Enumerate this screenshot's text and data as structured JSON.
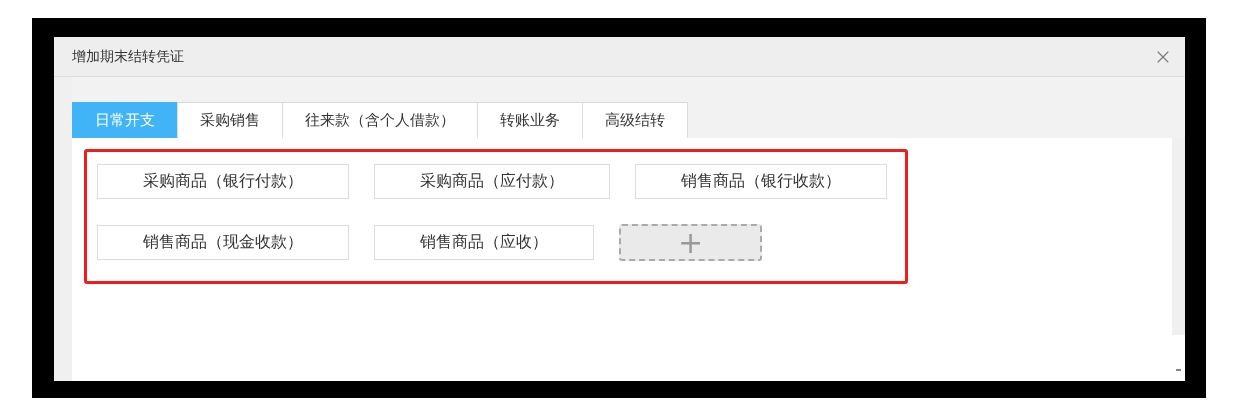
{
  "dialog": {
    "title": "增加期末结转凭证"
  },
  "tabs": [
    {
      "label": "日常开支",
      "selected": true
    },
    {
      "label": "采购销售",
      "selected": false
    },
    {
      "label": "往来款（含个人借款）",
      "selected": false
    },
    {
      "label": "转账业务",
      "selected": false
    },
    {
      "label": "高级结转",
      "selected": false
    }
  ],
  "template_rows": [
    [
      {
        "kind": "template",
        "label": "采购商品（银行付款）"
      },
      {
        "kind": "template",
        "label": "采购商品（应付款）"
      },
      {
        "kind": "template",
        "label": "销售商品（银行收款）"
      }
    ],
    [
      {
        "kind": "template",
        "label": "销售商品（现金收款）"
      },
      {
        "kind": "template",
        "label": "销售商品（应收）"
      },
      {
        "kind": "add",
        "label": "+"
      }
    ]
  ]
}
